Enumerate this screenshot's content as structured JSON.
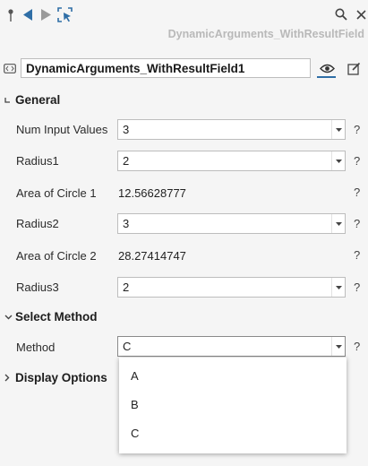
{
  "toolbar": {
    "icons": [
      "pin-icon",
      "back-icon",
      "forward-icon",
      "select-icon",
      "search-icon",
      "close-icon"
    ]
  },
  "header": {
    "title": "DynamicArguments_WithResultField"
  },
  "name_row": {
    "value": "DynamicArguments_WithResultField1"
  },
  "sections": {
    "general": {
      "label": "General"
    },
    "select_method": {
      "label": "Select Method"
    },
    "display_options": {
      "label": "Display Options"
    }
  },
  "general": {
    "num_input_values": {
      "label": "Num Input Values",
      "value": "3"
    },
    "radius1": {
      "label": "Radius1",
      "value": "2"
    },
    "area1": {
      "label": "Area of Circle 1",
      "value": "12.56628777"
    },
    "radius2": {
      "label": "Radius2",
      "value": "3"
    },
    "area2": {
      "label": "Area of Circle 2",
      "value": "28.27414747"
    },
    "radius3": {
      "label": "Radius3",
      "value": "2"
    }
  },
  "method": {
    "label": "Method",
    "value": "C",
    "options": [
      "A",
      "B",
      "C"
    ]
  },
  "help_glyph": "?",
  "colors": {
    "accent": "#2f6ea6",
    "background": "#f5f5f5",
    "muted_title": "#b9b9b9"
  }
}
